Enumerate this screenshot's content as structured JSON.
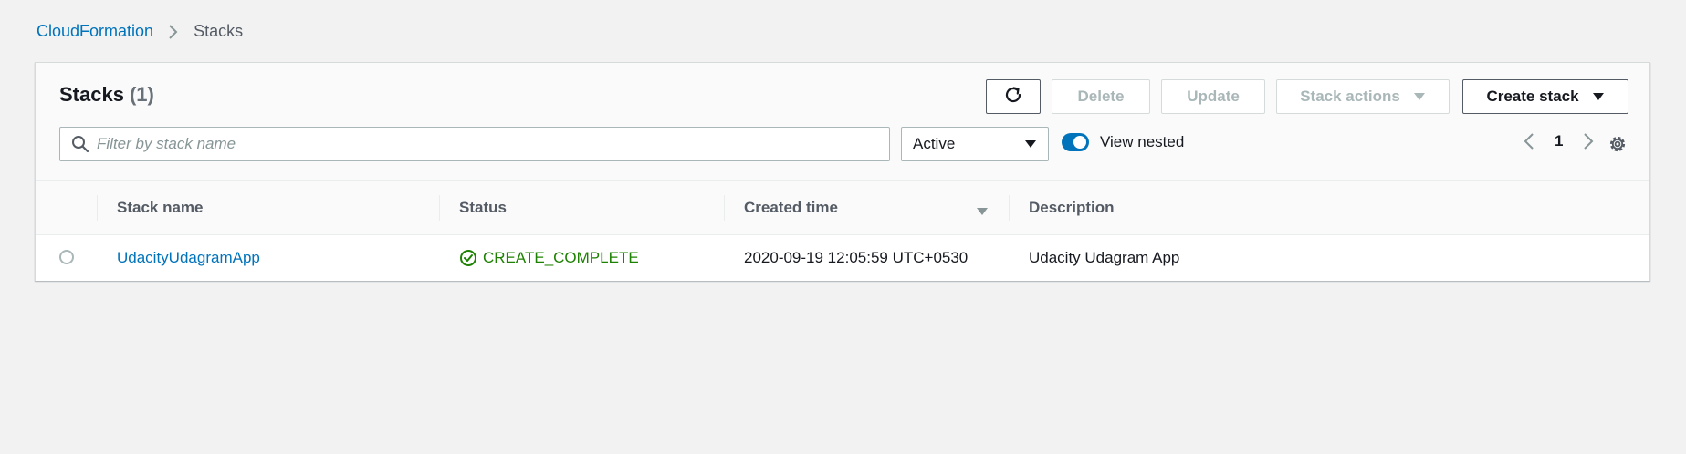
{
  "breadcrumb": {
    "root": "CloudFormation",
    "current": "Stacks"
  },
  "header": {
    "title": "Stacks",
    "count": "(1)"
  },
  "toolbar": {
    "delete_label": "Delete",
    "update_label": "Update",
    "stack_actions_label": "Stack actions",
    "create_stack_label": "Create stack"
  },
  "filter": {
    "placeholder": "Filter by stack name",
    "status_selected": "Active",
    "view_nested_label": "View nested",
    "view_nested_on": true
  },
  "pagination": {
    "page": "1"
  },
  "table": {
    "columns": [
      "Stack name",
      "Status",
      "Created time",
      "Description"
    ],
    "rows": [
      {
        "name": "UdacityUdagramApp",
        "status": "CREATE_COMPLETE",
        "created": "2020-09-19 12:05:59 UTC+0530",
        "description": "Udacity Udagram App"
      }
    ]
  },
  "colors": {
    "link": "#0073bb",
    "success": "#1d8102",
    "toggle_on": "#0073bb"
  }
}
